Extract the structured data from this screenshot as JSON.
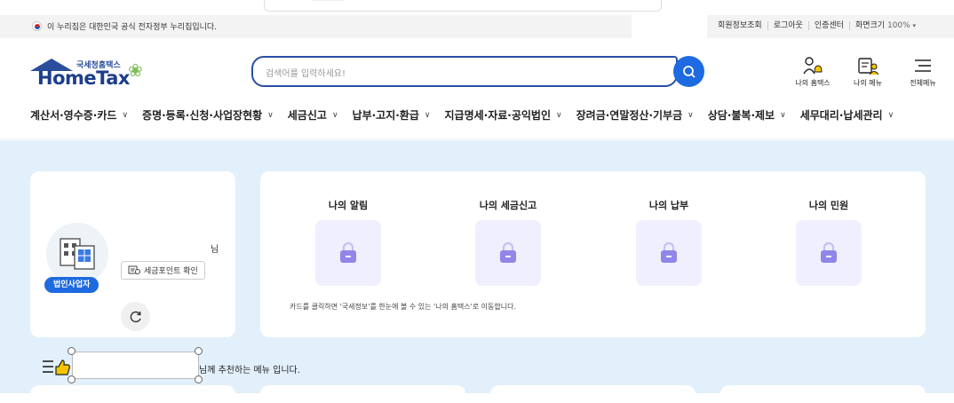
{
  "gov_bar": {
    "notice": "이 누리집은 대한민국 공식 전자정부 누리집입니다.",
    "utils": [
      "회원정보조회",
      "로그아웃",
      "인증센터"
    ],
    "zoom_label": "화면크기",
    "zoom_value": "100%"
  },
  "logo": {
    "sub": "국세청홈택스",
    "main": "HomeTax"
  },
  "search": {
    "placeholder": "검색어를 입력하세요!"
  },
  "header_menu": [
    {
      "label": "나의 홈택스"
    },
    {
      "label": "나의 메뉴"
    },
    {
      "label": "전체메뉴"
    }
  ],
  "gnb": [
    "계산서·영수증·카드",
    "증명·등록·신청·사업장현황",
    "세금신고",
    "납부·고지·환급",
    "지급명세·자료·공익법인",
    "장려금·연말정산·기부금",
    "상담·불복·제보",
    "세무대리·납세관리"
  ],
  "profile": {
    "suffix": "님",
    "badge": "법인사업자",
    "point_button": "세금포인트 확인"
  },
  "quick": {
    "items": [
      "나의 알림",
      "나의 세금신고",
      "나의 납부",
      "나의 민원"
    ],
    "desc": "카드를 클릭하면 '국세정보'를 한눈에 볼 수 있는 '나의 홈택스'로 이동합니다."
  },
  "recommend": {
    "text": "님께 추천하는 메뉴 입니다."
  },
  "colors": {
    "primary": "#1e6ae0",
    "navy": "#1d3e8a",
    "content_bg": "#e2f0fb",
    "lock": "#8f86e8"
  }
}
